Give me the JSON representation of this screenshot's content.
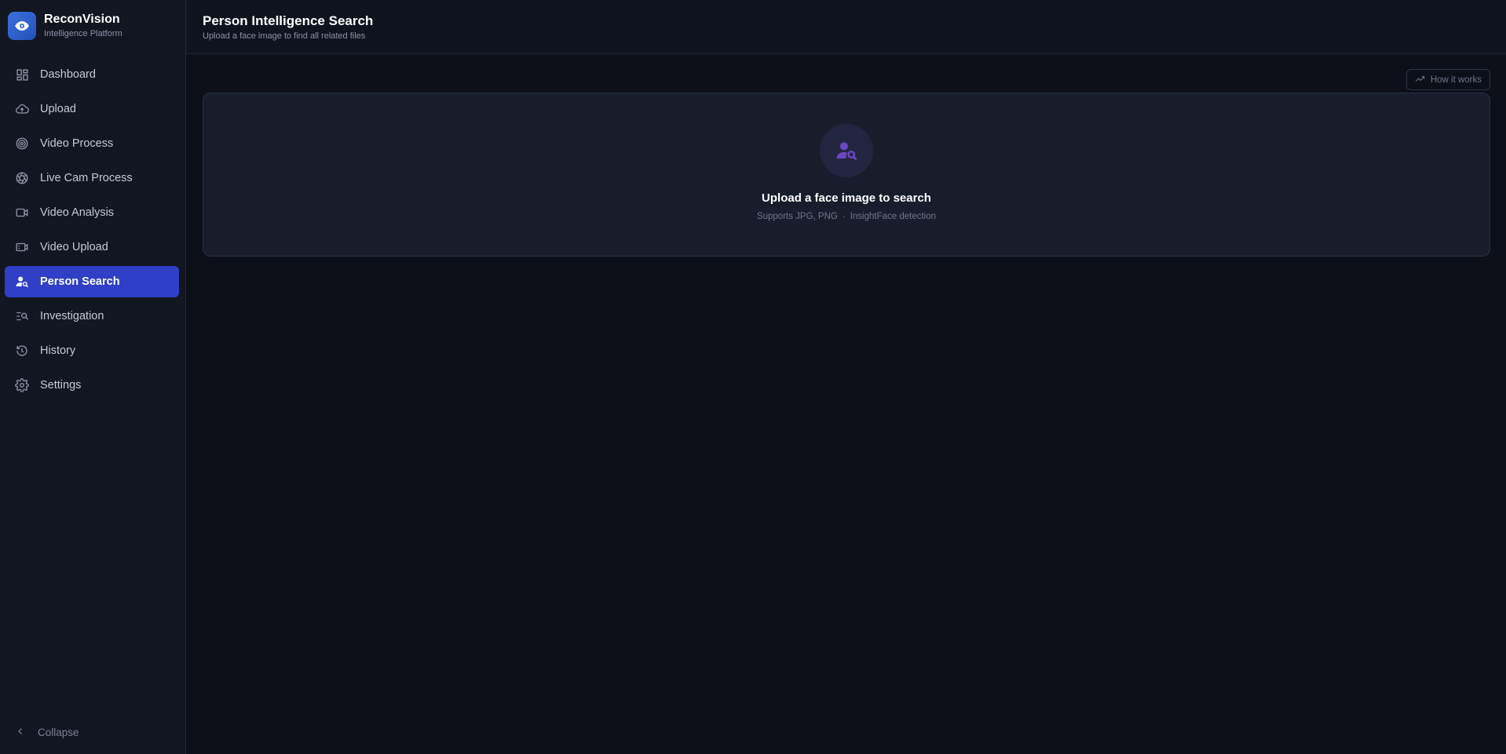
{
  "brand": {
    "name": "ReconVision",
    "subtitle": "Intelligence Platform"
  },
  "sidebar": {
    "items": [
      {
        "label": "Dashboard",
        "icon": "dashboard-icon"
      },
      {
        "label": "Upload",
        "icon": "cloud-upload-icon"
      },
      {
        "label": "Video Process",
        "icon": "target-icon"
      },
      {
        "label": "Live Cam Process",
        "icon": "aperture-icon"
      },
      {
        "label": "Video Analysis",
        "icon": "video-camera-icon"
      },
      {
        "label": "Video Upload",
        "icon": "video-file-icon"
      },
      {
        "label": "Person Search",
        "icon": "person-search-icon",
        "active": true
      },
      {
        "label": "Investigation",
        "icon": "list-search-icon"
      },
      {
        "label": "History",
        "icon": "history-icon"
      },
      {
        "label": "Settings",
        "icon": "gear-icon"
      }
    ],
    "collapse_label": "Collapse"
  },
  "header": {
    "title": "Person Intelligence Search",
    "subtitle": "Upload a face image to find all related files"
  },
  "how_it_works": {
    "label": "How it works"
  },
  "dropzone": {
    "title": "Upload a face image to search",
    "formats": "Supports JPG, PNG",
    "separator": "·",
    "engine": "InsightFace detection"
  },
  "colors": {
    "accent": "#2f3fc6",
    "background": "#0c0f18",
    "sidebar": "#121621",
    "dropzone_icon": "#6b46c1"
  }
}
